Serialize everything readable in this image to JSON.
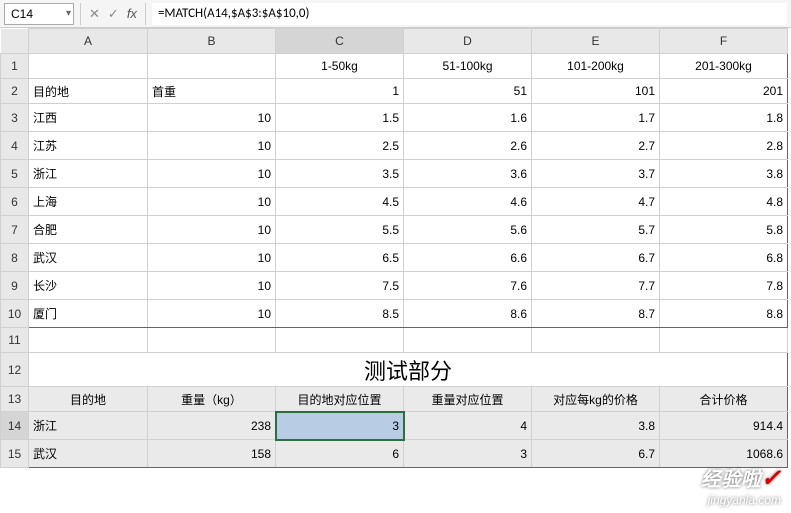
{
  "name_box": "C14",
  "formula": "=MATCH(A14,$A$3:$A$10,0)",
  "columns": [
    "A",
    "B",
    "C",
    "D",
    "E",
    "F"
  ],
  "row1": {
    "C": "1-50kg",
    "D": "51-100kg",
    "E": "101-200kg",
    "F": "201-300kg"
  },
  "row2": {
    "A": "目的地",
    "B": "首重",
    "C": "1",
    "D": "51",
    "E": "101",
    "F": "201"
  },
  "rates": [
    {
      "A": "江西",
      "B": "10",
      "C": "1.5",
      "D": "1.6",
      "E": "1.7",
      "F": "1.8"
    },
    {
      "A": "江苏",
      "B": "10",
      "C": "2.5",
      "D": "2.6",
      "E": "2.7",
      "F": "2.8"
    },
    {
      "A": "浙江",
      "B": "10",
      "C": "3.5",
      "D": "3.6",
      "E": "3.7",
      "F": "3.8"
    },
    {
      "A": "上海",
      "B": "10",
      "C": "4.5",
      "D": "4.6",
      "E": "4.7",
      "F": "4.8"
    },
    {
      "A": "合肥",
      "B": "10",
      "C": "5.5",
      "D": "5.6",
      "E": "5.7",
      "F": "5.8"
    },
    {
      "A": "武汉",
      "B": "10",
      "C": "6.5",
      "D": "6.6",
      "E": "6.7",
      "F": "6.8"
    },
    {
      "A": "长沙",
      "B": "10",
      "C": "7.5",
      "D": "7.6",
      "E": "7.7",
      "F": "7.8"
    },
    {
      "A": "厦门",
      "B": "10",
      "C": "8.5",
      "D": "8.6",
      "E": "8.7",
      "F": "8.8"
    }
  ],
  "section_title": "测试部分",
  "row13": {
    "A": "目的地",
    "B": "重量（kg）",
    "C": "目的地对应位置",
    "D": "重量对应位置",
    "E": "对应每kg的价格",
    "F": "合计价格"
  },
  "results": [
    {
      "A": "浙江",
      "B": "238",
      "C": "3",
      "D": "4",
      "E": "3.8",
      "F": "914.4"
    },
    {
      "A": "武汉",
      "B": "158",
      "C": "6",
      "D": "3",
      "E": "6.7",
      "F": "1068.6"
    }
  ],
  "watermark": {
    "line1": "经验啦",
    "line2": "jingyanla.com"
  }
}
